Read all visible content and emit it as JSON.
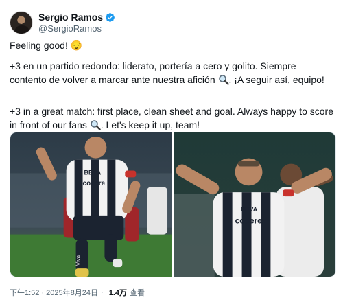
{
  "author": {
    "display_name": "Sergio Ramos",
    "handle": "@SergioRamos"
  },
  "tweet": {
    "line1": "Feeling good! 😌",
    "spanish_part1": "+3 en un partido redondo: liderato, portería a cero y golito. Siempre contento de volver a marcar ante nuestra afición",
    "spanish_part2": ". ¡A seguir así, equipo!",
    "english_part1": "+3 in a great match: first place, clean sheet and goal. Always happy to score in front of our fans",
    "english_part2": ". Let's keep it up, team!"
  },
  "media": {
    "photo1_sponsor": "codere",
    "photo1_badge": "BBVA",
    "photo1_sock": "Viva",
    "photo2_badge": "BBVA",
    "photo2_sponsor": "codere"
  },
  "meta": {
    "timestamp": "下午1:52 · 2025年8月24日",
    "separator": "·",
    "views_count": "1.4万",
    "views_label": "查看"
  },
  "colors": {
    "verified": "#1d9bf0",
    "text": "#0f1419",
    "secondary": "#536471"
  },
  "icons": {
    "verified": "verified-badge-icon",
    "magnifier": "magnifier-emoji-icon"
  }
}
